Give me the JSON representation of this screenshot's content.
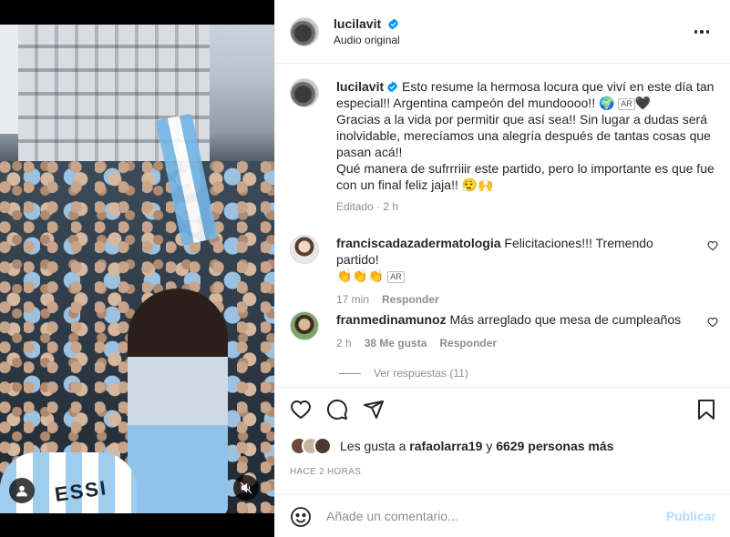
{
  "post": {
    "author": "lucilavit",
    "audio": "Audio original"
  },
  "caption": {
    "author": "lucilavit",
    "text": "Esto resume la hermosa locura que viví en este día tan especial!! Argentina campeón del mundoooo!! 🌍",
    "text_flag": "AR",
    "text_heart": "🖤",
    "text2": "Gracias a la vida por permitir que así sea!! Sin lugar a dudas será inolvidable, merecíamos una alegría después de tantas cosas que pasan acá!!\nQué manera de sufrrriiir este partido, pero lo importante es que fue con un final feliz jaja!! 😮‍💨🙌",
    "meta": "Editado · 2 h"
  },
  "comments": [
    {
      "user": "franciscadazadermatologia",
      "text": "Felicitaciones!!! Tremendo partido!",
      "emojis": "👏👏👏",
      "flag": "AR",
      "time": "17 min",
      "reply_label": "Responder"
    },
    {
      "user": "franmedinamunoz",
      "text": "Más arreglado que mesa de cumpleaños",
      "time": "2 h",
      "likes": "38 Me gusta",
      "reply_label": "Responder"
    }
  ],
  "view_replies": "Ver respuestas (11)",
  "likes": {
    "prefix": "Les gusta a",
    "user": "rafaolarra19",
    "middle": "y",
    "count": "6629 personas más"
  },
  "time_ago": "HACE 2 HORAS",
  "composer": {
    "placeholder": "Añade un comentario...",
    "publish": "Publicar"
  },
  "media": {
    "jersey_text": "ESSI"
  },
  "colors": {
    "verified": "#0095f6",
    "publish_disabled": "#b3dbff",
    "secondary_text": "#8e8e8e"
  },
  "icons": [
    "verified-icon",
    "more-icon",
    "heart-icon",
    "comment-icon",
    "share-icon",
    "bookmark-icon",
    "emoji-icon",
    "user-tag-icon",
    "mute-icon"
  ]
}
